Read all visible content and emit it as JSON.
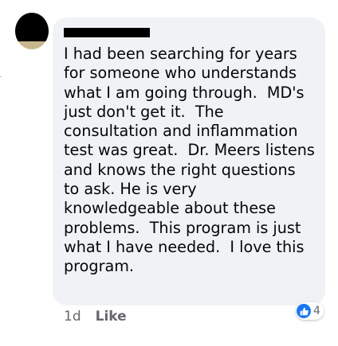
{
  "comment": {
    "text_lines": [
      "I had been searching for years",
      "for someone who understands",
      "what I am going through.  MD's",
      "just don't get it.  The",
      "consultation and inflammation",
      "test was great.  Dr. Meers listens",
      "and knows the right questions",
      "to ask. He is very",
      "knowledgeable about these",
      "problems.  This program is just",
      "what I have needed.  I love this",
      "program."
    ],
    "time": "1d",
    "like_label": "Like",
    "reaction_count": "4",
    "reaction_icon": "like-thumb-icon"
  },
  "colors": {
    "bubble": "#f0f2f5",
    "text": "#050505",
    "secondary": "#65676b",
    "like_blue": "#1877f2"
  }
}
